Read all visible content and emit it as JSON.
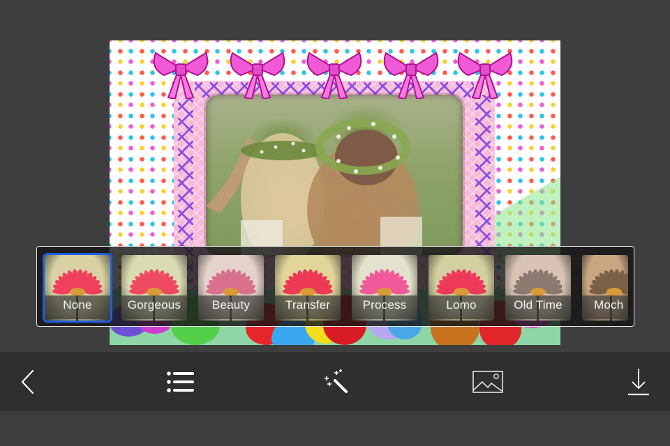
{
  "editor": {
    "frame_theme": "pink bows and stars",
    "photo_subject": "two girls with flower crowns in a meadow"
  },
  "filters": {
    "selected": "None",
    "accent_color": "#1f5fe0",
    "items": [
      {
        "label": "None",
        "tint": "#d8d2a4",
        "petal": "#f0405e"
      },
      {
        "label": "Gorgeous",
        "tint": "#d9dcb2",
        "petal": "#f04a62"
      },
      {
        "label": "Beauty",
        "tint": "#e4d2cb",
        "petal": "#d9708e"
      },
      {
        "label": "Transfer",
        "tint": "#e2d59a",
        "petal": "#ec3a55"
      },
      {
        "label": "Process",
        "tint": "#e3e2cc",
        "petal": "#f05a9a"
      },
      {
        "label": "Lomo",
        "tint": "#d2d09e",
        "petal": "#ee3a5a"
      },
      {
        "label": "Old Time",
        "tint": "#d9c3b5",
        "petal": "#8a7a70"
      },
      {
        "label": "Moch",
        "tint": "#c9a582",
        "petal": "#7a6044"
      }
    ]
  },
  "toolbar": {
    "items": [
      {
        "name": "back",
        "icon": "chevron-left-icon"
      },
      {
        "name": "frames-list",
        "icon": "list-icon"
      },
      {
        "name": "effects",
        "icon": "magic-wand-icon"
      },
      {
        "name": "background-image",
        "icon": "image-icon"
      },
      {
        "name": "save",
        "icon": "download-icon"
      }
    ]
  }
}
